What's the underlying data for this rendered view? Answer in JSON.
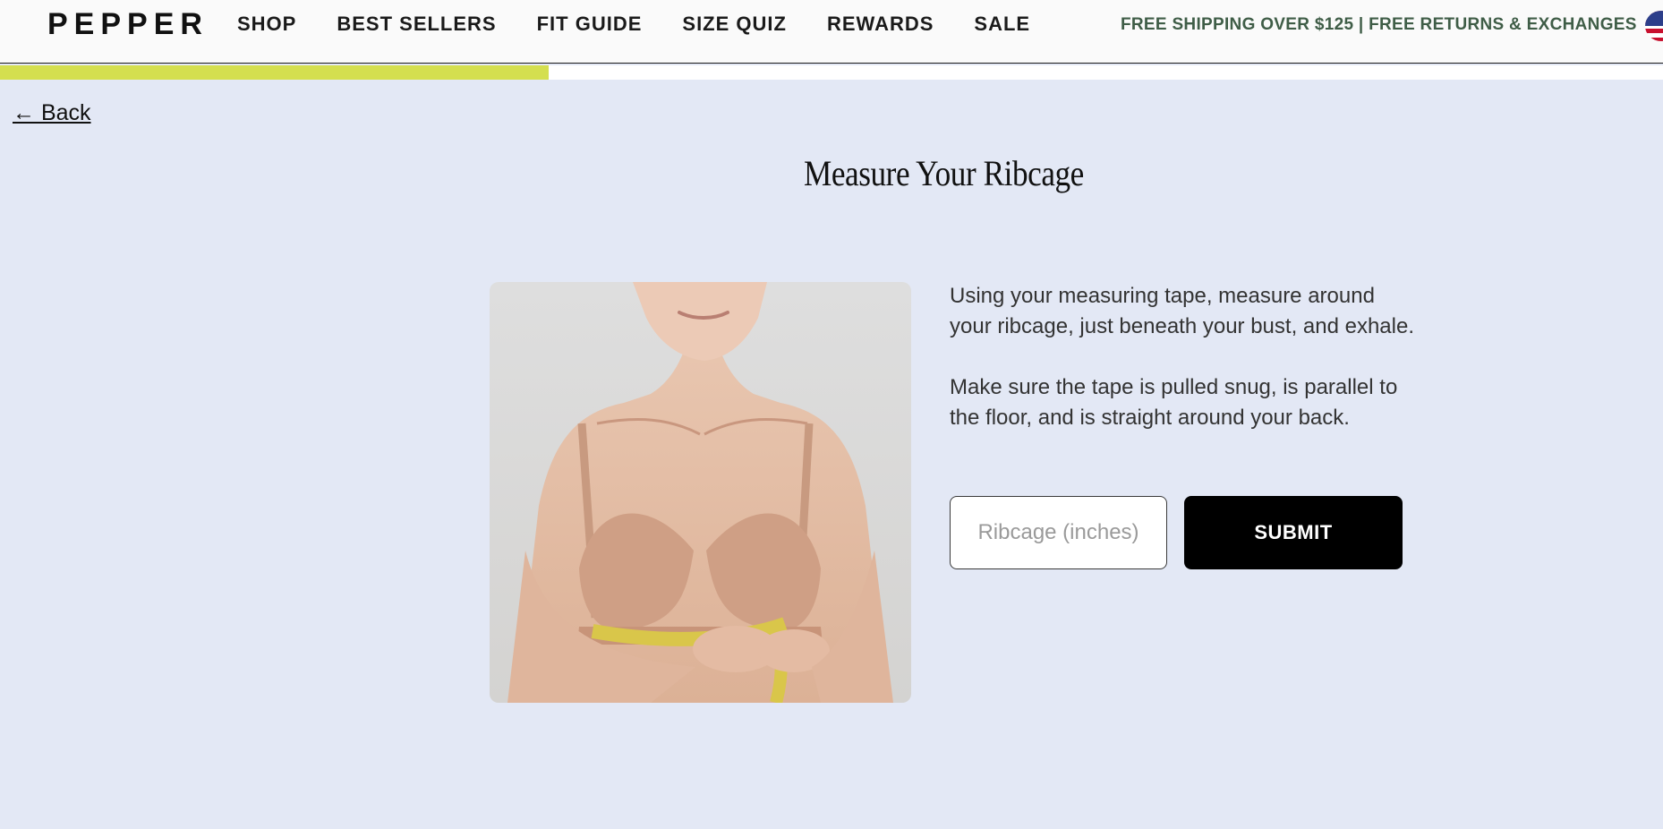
{
  "header": {
    "logo": "PEPPER",
    "nav": [
      {
        "label": "SHOP"
      },
      {
        "label": "BEST SELLERS"
      },
      {
        "label": "FIT GUIDE"
      },
      {
        "label": "SIZE QUIZ"
      },
      {
        "label": "REWARDS"
      },
      {
        "label": "SALE"
      }
    ],
    "promo": "FREE SHIPPING OVER $125 | FREE RETURNS & EXCHANGES",
    "region_icon": "us-flag-icon"
  },
  "progress": {
    "fraction": 0.33,
    "color": "#d4df4f"
  },
  "back_link": "← Back",
  "step": {
    "title": "Measure Your Ribcage",
    "instructions": [
      "Using your measuring tape, measure around your ribcage, just beneath your bust, and exhale.",
      "Make sure the tape is pulled snug, is parallel to the floor, and is straight around your back."
    ],
    "input": {
      "placeholder": "Ribcage (inches)",
      "value": ""
    },
    "submit_label": "SUBMIT"
  },
  "colors": {
    "page_background": "#e3e8f5",
    "accent": "#d4df4f",
    "promo_text": "#3f5d47",
    "button": "#000000"
  }
}
